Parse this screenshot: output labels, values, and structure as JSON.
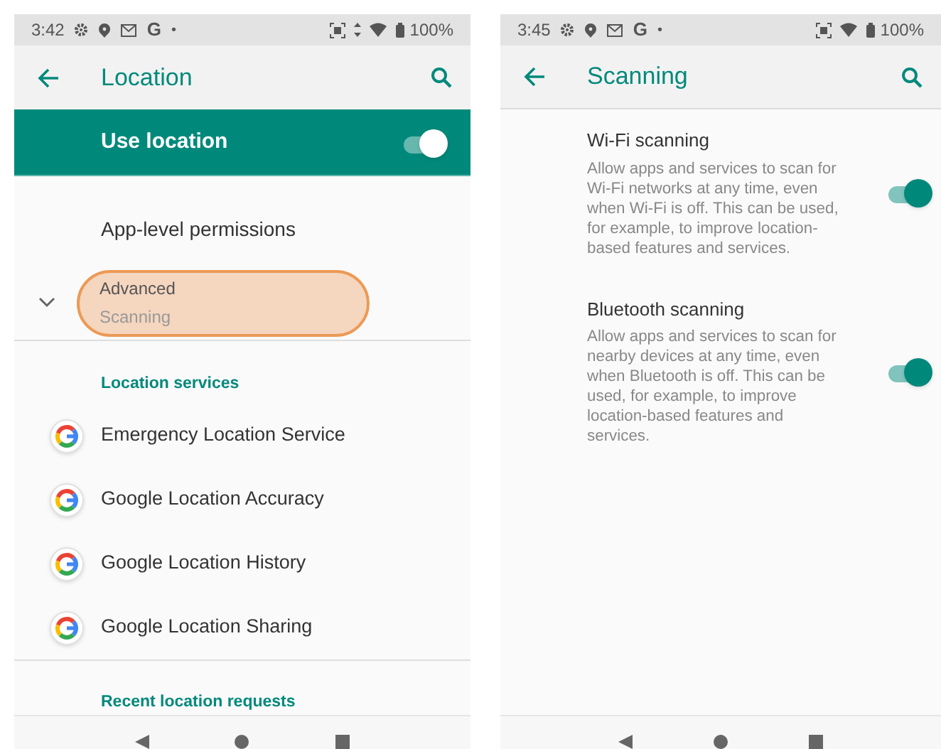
{
  "screens": [
    {
      "status_bar": {
        "time": "3:42",
        "left_icons": [
          {
            "kind": "gear"
          },
          {
            "kind": "message"
          },
          {
            "kind": "mail"
          }
        ],
        "letter": "G",
        "dot": "•",
        "right_icons": [
          {
            "kind": "scan"
          },
          {
            "kind": "vibrate"
          },
          {
            "kind": "wifi"
          },
          {
            "kind": "battery"
          }
        ],
        "battery": "100%"
      },
      "toolbar": {
        "title": "Location"
      },
      "master_switch": {
        "label": "Use location",
        "on": true
      },
      "items": [
        {
          "kind": "plain",
          "title": "App-level permissions"
        },
        {
          "kind": "expand",
          "title": "Advanced",
          "subtitle": "Scanning",
          "highlighted": true
        },
        {
          "kind": "header",
          "title": "Location services"
        },
        {
          "kind": "service",
          "title": "Emergency Location Service"
        },
        {
          "kind": "service",
          "title": "Google Location Accuracy"
        },
        {
          "kind": "service",
          "title": "Google Location History"
        },
        {
          "kind": "service",
          "title": "Google Location Sharing"
        },
        {
          "kind": "divided_header",
          "title": "Recent location requests"
        }
      ]
    },
    {
      "status_bar": {
        "time": "3:45",
        "left_icons": [
          {
            "kind": "gear"
          },
          {
            "kind": "message"
          },
          {
            "kind": "mail"
          }
        ],
        "letter": "G",
        "dot": "•",
        "right_icons": [
          {
            "kind": "scan"
          },
          {
            "kind": "wifi"
          },
          {
            "kind": "battery"
          }
        ],
        "battery": "100%"
      },
      "toolbar": {
        "title": "Scanning"
      },
      "items": [
        {
          "kind": "toggle",
          "title": "Wi-Fi scanning",
          "description": "Allow apps and services to scan for Wi-Fi networks at any time, even when Wi-Fi is off. This can be used, for example, to improve location-based features and services.",
          "on": true
        },
        {
          "kind": "toggle",
          "title": "Bluetooth scanning",
          "description": "Allow apps and services to scan for nearby devices at any time, even when Bluetooth is off. This can be used, for example, to improve location-based features and services.",
          "on": true
        }
      ]
    }
  ]
}
